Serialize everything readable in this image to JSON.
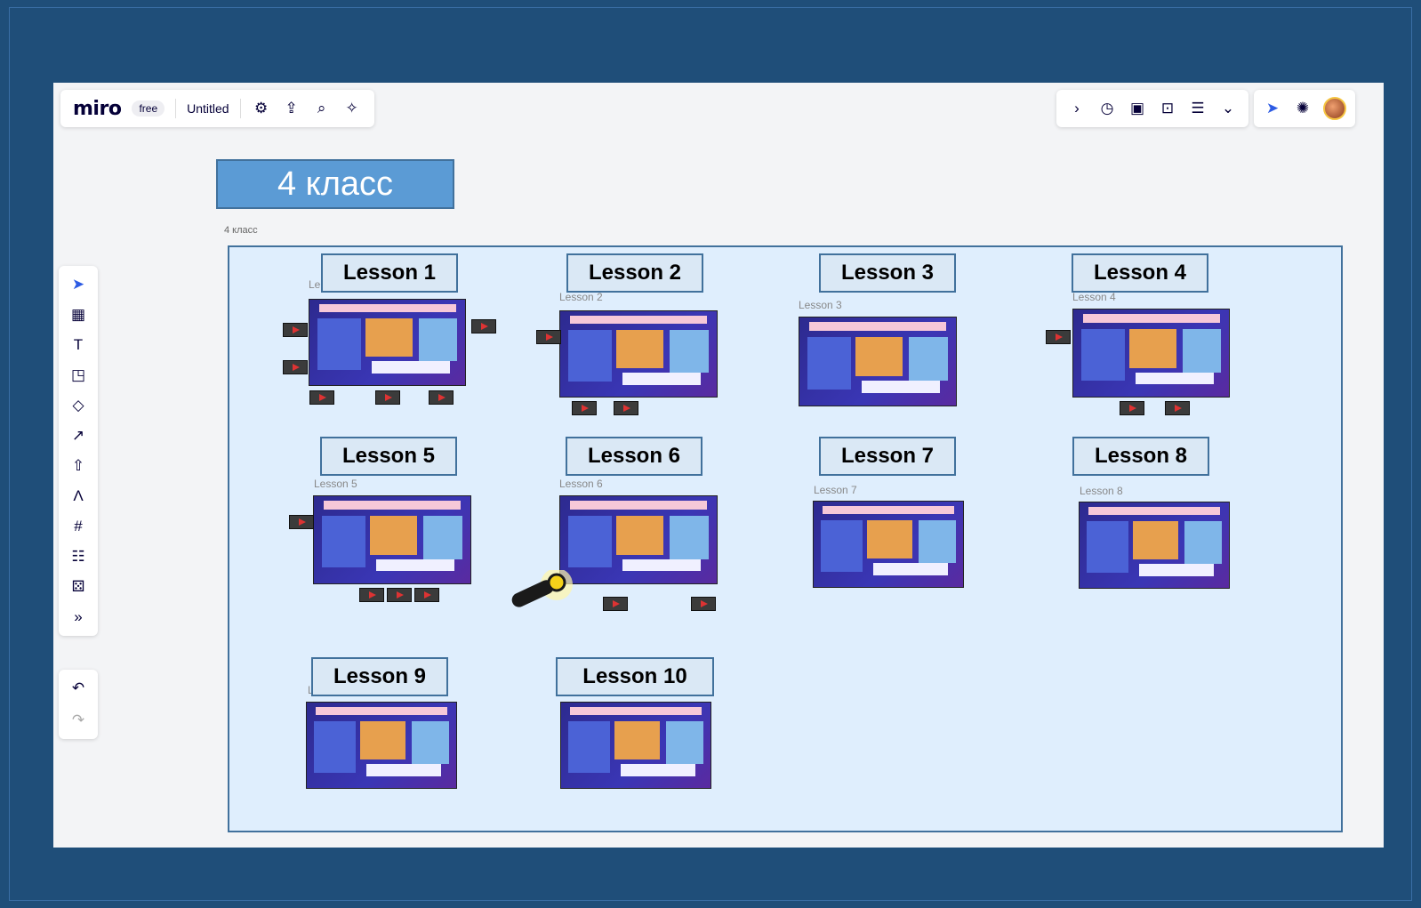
{
  "app": {
    "logo": "miro",
    "plan_badge": "free",
    "board_title": "Untitled"
  },
  "board": {
    "big_title": "4 класс",
    "frame_label": "4 класс",
    "lessons": [
      {
        "label": "Lesson 1",
        "sub": "Le"
      },
      {
        "label": "Lesson 2",
        "sub": "Lesson 2"
      },
      {
        "label": "Lesson 3",
        "sub": "Lesson 3"
      },
      {
        "label": "Lesson 4",
        "sub": "Lesson 4"
      },
      {
        "label": "Lesson 5",
        "sub": "Lesson 5"
      },
      {
        "label": "Lesson 6",
        "sub": "Lesson 6"
      },
      {
        "label": "Lesson 7",
        "sub": "Lesson 7"
      },
      {
        "label": "Lesson 8",
        "sub": "Lesson 8"
      },
      {
        "label": "Lesson 9",
        "sub": "L"
      },
      {
        "label": "Lesson 10",
        "sub": ""
      }
    ]
  },
  "colors": {
    "background": "#1f4e79",
    "frame_fill": "#dfeefd",
    "label_border": "#41719c",
    "title_fill": "#5b9bd5"
  }
}
